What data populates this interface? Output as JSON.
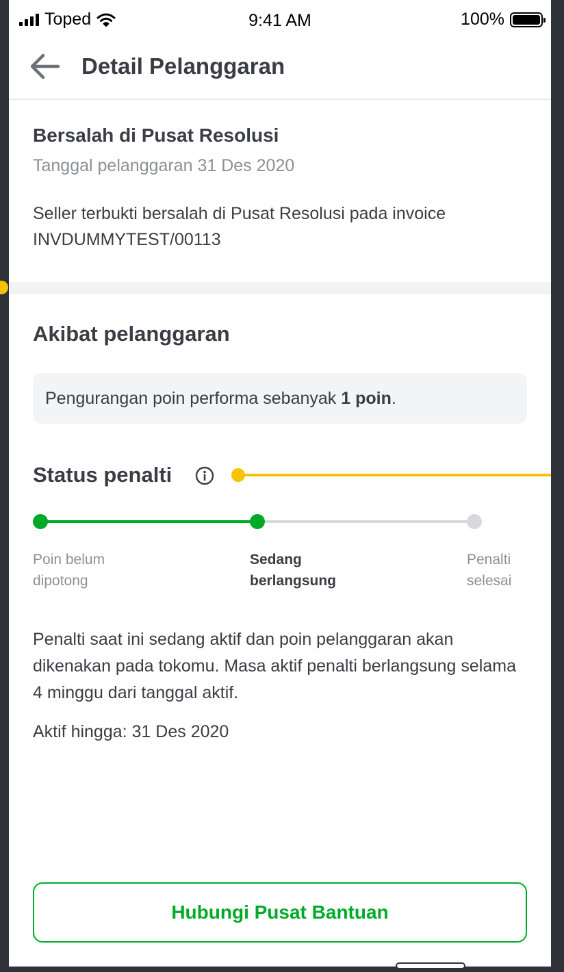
{
  "status_bar": {
    "carrier": "Toped",
    "time": "9:41 AM",
    "battery": "100%"
  },
  "app_bar": {
    "title": "Detail Pelanggaran"
  },
  "violation": {
    "title": "Bersalah di Pusat Resolusi",
    "date": "Tanggal pelanggaran 31 Des 2020",
    "description": "Seller terbukti bersalah di Pusat Resolusi pada invoice INVDUMMYTEST/00113"
  },
  "effect": {
    "heading": "Akibat pelanggaran",
    "text_prefix": "Pengurangan poin performa sebanyak ",
    "text_bold": "1 poin",
    "text_suffix": "."
  },
  "penalty": {
    "heading": "Status penalti",
    "current_step": 2,
    "steps": [
      {
        "label_line1": "Poin belum",
        "label_line2": "dipotong"
      },
      {
        "label_line1": "Sedang",
        "label_line2": "berlangsung"
      },
      {
        "label_line1": "Penalti",
        "label_line2": "selesai"
      }
    ],
    "description": "Penalti saat ini sedang aktif dan poin pelanggaran akan dikenakan pada tokomu. Masa aktif penalti berlangsung selama 4 minggu dari tanggal aktif.",
    "active_until": "Aktif hingga: 31 Des 2020"
  },
  "help_button": {
    "label": "Hubungi Pusat Bantuan"
  },
  "colors": {
    "accent_green": "#00aa28",
    "annotation_yellow": "#f7c200",
    "inactive_gray": "#d6d8dc"
  }
}
